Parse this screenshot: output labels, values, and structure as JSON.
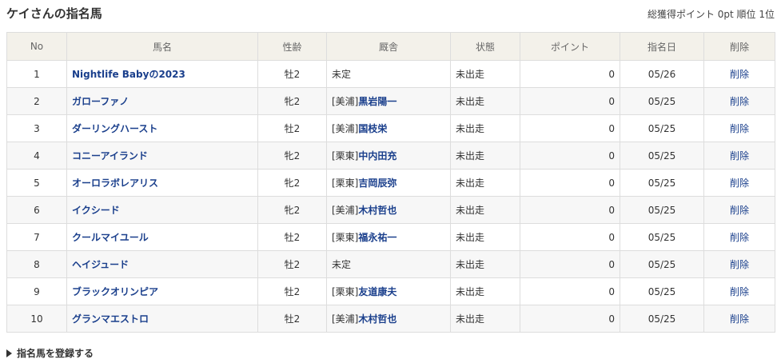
{
  "header": {
    "title": "ケイさんの指名馬",
    "stats": "総獲得ポイント 0pt 順位 1位"
  },
  "columns": [
    "No",
    "馬名",
    "性齢",
    "厩舎",
    "状態",
    "ポイント",
    "指名日",
    "削除"
  ],
  "rows": [
    {
      "no": "1",
      "name": "Nightlife Babyの2023",
      "sexage": "牡2",
      "stable_prefix": "",
      "trainer": "未定",
      "status": "未出走",
      "points": "0",
      "date": "05/26",
      "delete": "削除"
    },
    {
      "no": "2",
      "name": "ガローファノ",
      "sexage": "牝2",
      "stable_prefix": "[美浦]",
      "trainer": "黒岩陽一",
      "status": "未出走",
      "points": "0",
      "date": "05/25",
      "delete": "削除"
    },
    {
      "no": "3",
      "name": "ダーリングハースト",
      "sexage": "牡2",
      "stable_prefix": "[美浦]",
      "trainer": "国枝栄",
      "status": "未出走",
      "points": "0",
      "date": "05/25",
      "delete": "削除"
    },
    {
      "no": "4",
      "name": "コニーアイランド",
      "sexage": "牝2",
      "stable_prefix": "[栗東]",
      "trainer": "中内田充",
      "status": "未出走",
      "points": "0",
      "date": "05/25",
      "delete": "削除"
    },
    {
      "no": "5",
      "name": "オーロラボレアリス",
      "sexage": "牝2",
      "stable_prefix": "[栗東]",
      "trainer": "吉岡辰弥",
      "status": "未出走",
      "points": "0",
      "date": "05/25",
      "delete": "削除"
    },
    {
      "no": "6",
      "name": "イクシード",
      "sexage": "牝2",
      "stable_prefix": "[美浦]",
      "trainer": "木村哲也",
      "status": "未出走",
      "points": "0",
      "date": "05/25",
      "delete": "削除"
    },
    {
      "no": "7",
      "name": "クールマイユール",
      "sexage": "牡2",
      "stable_prefix": "[栗東]",
      "trainer": "福永祐一",
      "status": "未出走",
      "points": "0",
      "date": "05/25",
      "delete": "削除"
    },
    {
      "no": "8",
      "name": "ヘイジュード",
      "sexage": "牡2",
      "stable_prefix": "",
      "trainer": "未定",
      "status": "未出走",
      "points": "0",
      "date": "05/25",
      "delete": "削除"
    },
    {
      "no": "9",
      "name": "ブラックオリンピア",
      "sexage": "牡2",
      "stable_prefix": "[栗東]",
      "trainer": "友道康夫",
      "status": "未出走",
      "points": "0",
      "date": "05/25",
      "delete": "削除"
    },
    {
      "no": "10",
      "name": "グランマエストロ",
      "sexage": "牡2",
      "stable_prefix": "[美浦]",
      "trainer": "木村哲也",
      "status": "未出走",
      "points": "0",
      "date": "05/25",
      "delete": "削除"
    }
  ],
  "footer": {
    "register_label": "指名馬を登録する"
  }
}
